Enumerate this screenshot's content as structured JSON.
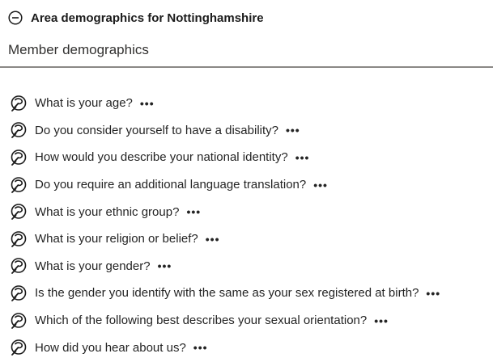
{
  "header": {
    "title": "Area demographics for Nottinghamshire",
    "collapse_icon": "minus-circle-icon"
  },
  "section": {
    "subtitle": "Member demographics"
  },
  "questions": [
    {
      "label": "What is your age?",
      "icon": "question-branch-icon",
      "more": "•••"
    },
    {
      "label": "Do you consider yourself to have a disability?",
      "icon": "question-branch-icon",
      "more": "•••"
    },
    {
      "label": "How would you describe your national identity?",
      "icon": "question-branch-icon",
      "more": "•••"
    },
    {
      "label": "Do you require an additional language translation?",
      "icon": "question-branch-icon",
      "more": "•••"
    },
    {
      "label": "What is your ethnic group?",
      "icon": "question-branch-icon",
      "more": "•••"
    },
    {
      "label": "What is your religion or belief?",
      "icon": "question-branch-icon",
      "more": "•••"
    },
    {
      "label": "What is your gender?",
      "icon": "question-branch-icon",
      "more": "•••"
    },
    {
      "label": "Is the gender you identify with the same as your sex registered at birth?",
      "icon": "question-branch-icon",
      "more": "•••"
    },
    {
      "label": "Which of the following best describes your sexual orientation?",
      "icon": "question-branch-icon",
      "more": "•••"
    },
    {
      "label": "How did you hear about us?",
      "icon": "question-branch-icon",
      "more": "•••"
    }
  ]
}
